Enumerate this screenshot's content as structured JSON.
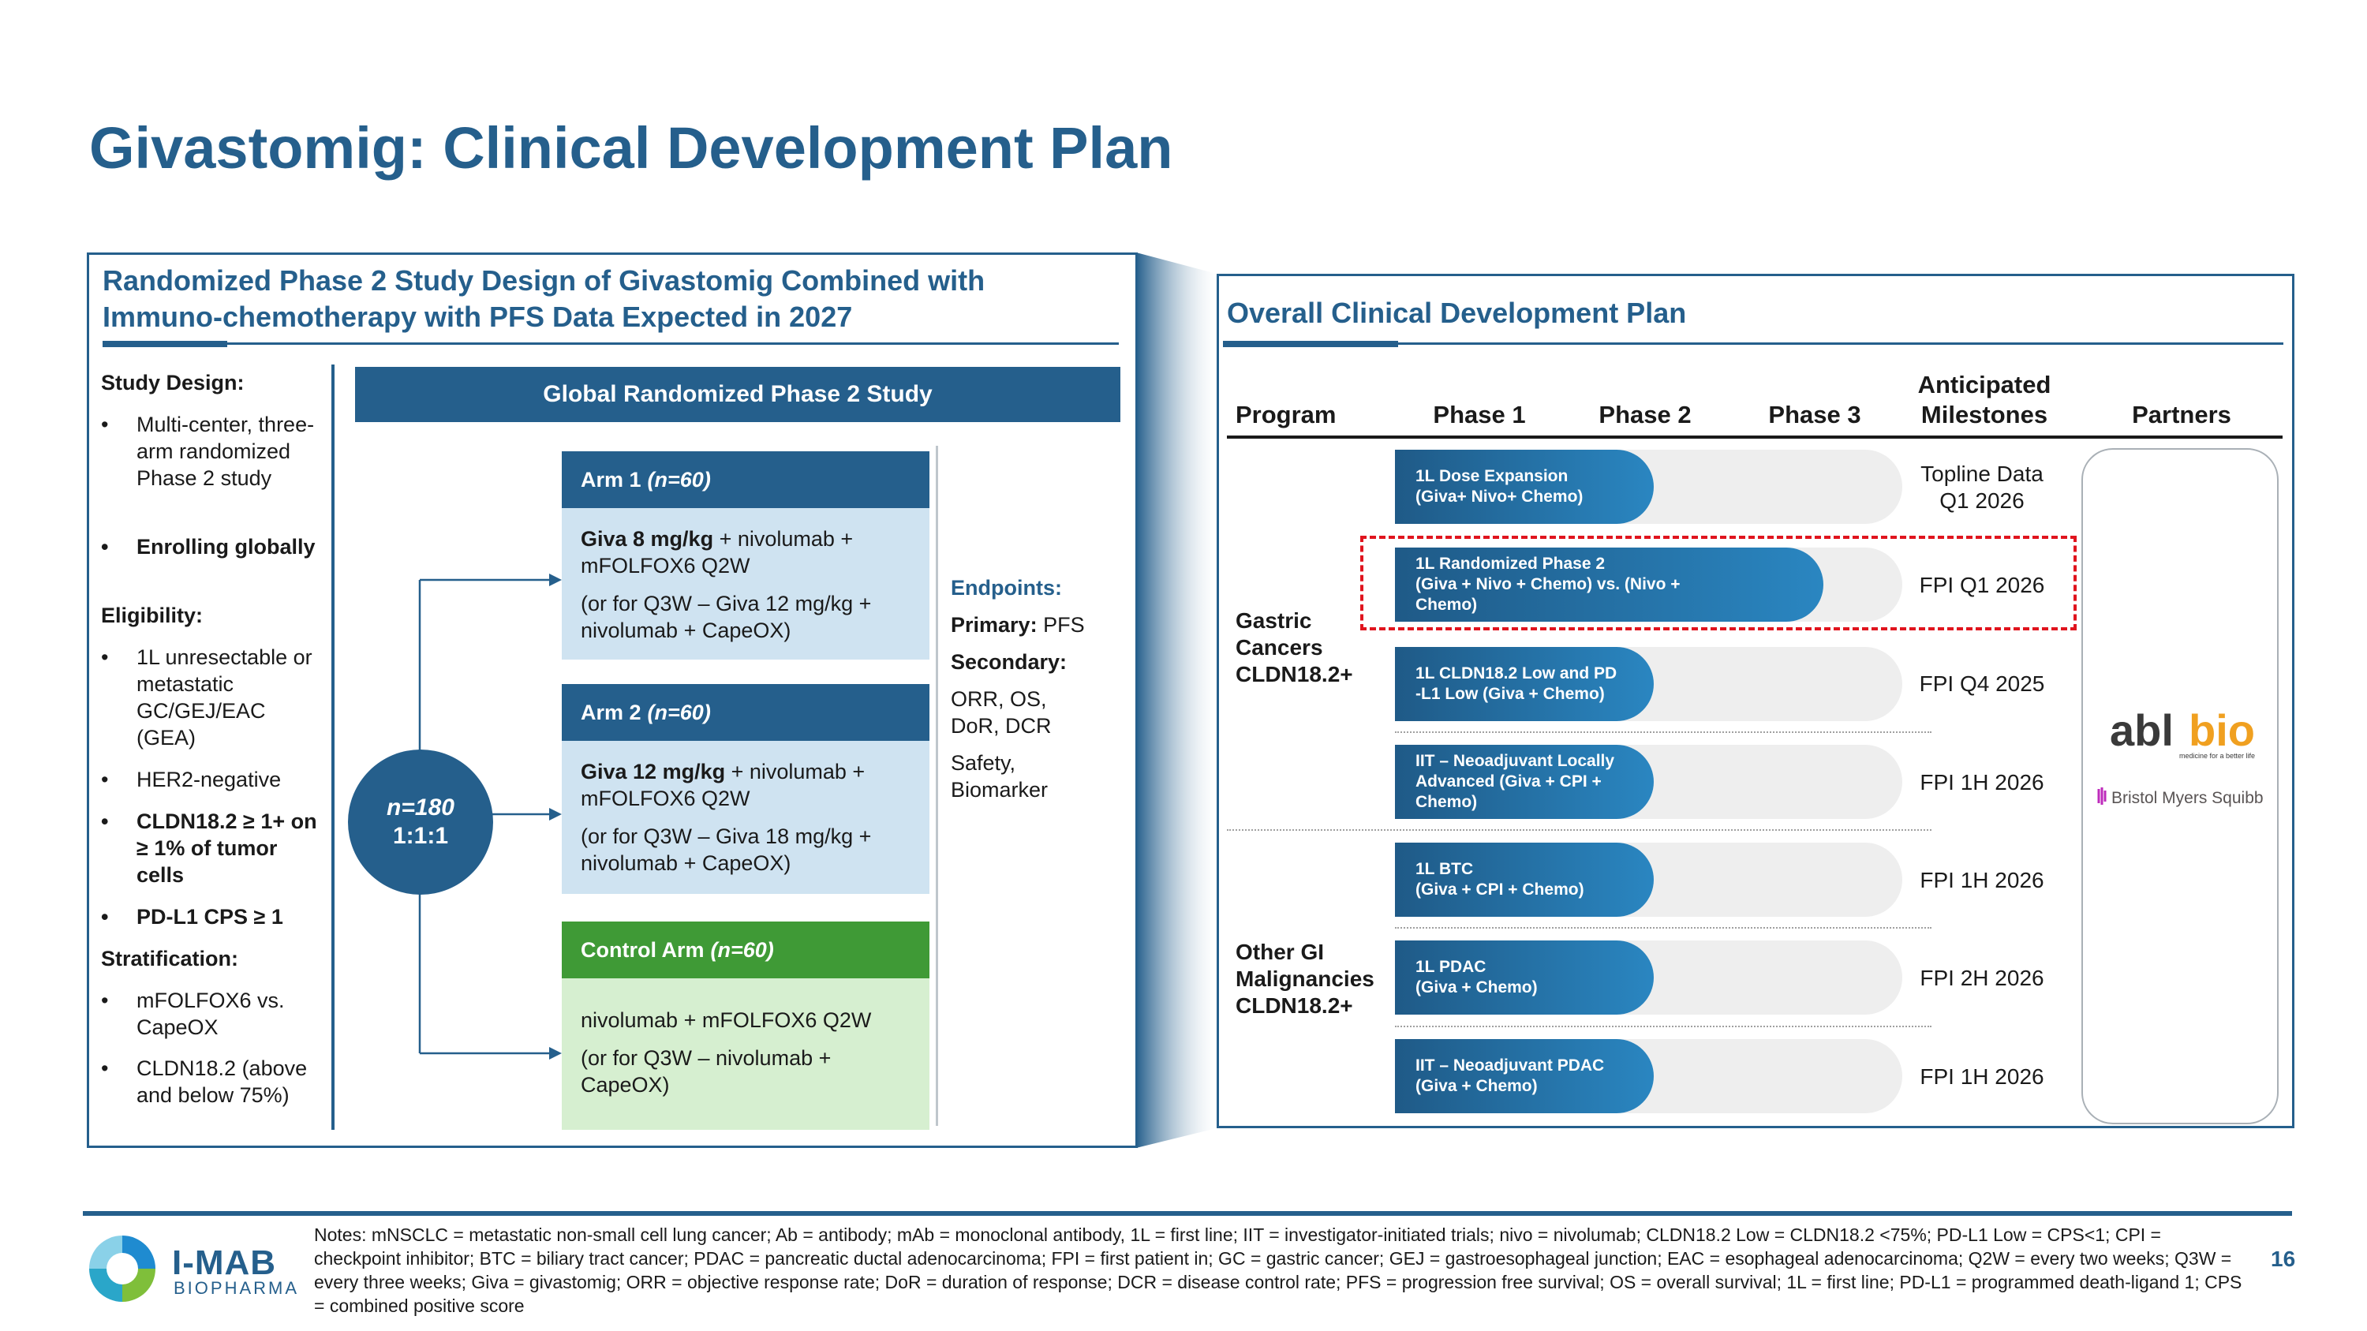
{
  "title": "Givastomig: Clinical Development Plan",
  "left_panel": {
    "heading_line1": "Randomized Phase 2 Study Design of Givastomig Combined with",
    "heading_line2": "Immuno-chemotherapy with PFS Data Expected in 2027",
    "study_design": {
      "heading": "Study Design:",
      "bullet1": "Multi-center, three-arm randomized Phase 2 study",
      "bullet2": "Enrolling globally"
    },
    "eligibility": {
      "heading": "Eligibility:",
      "bullet1": "1L unresectable or metastatic GC/GEJ/EAC (GEA)",
      "bullet2": "HER2-negative",
      "bullet3": "CLDN18.2 ≥ 1+ on ≥ 1% of tumor cells",
      "bullet4": "PD-L1 CPS ≥ 1"
    },
    "stratification": {
      "heading": "Stratification:",
      "bullet1": "mFOLFOX6 vs. CapeOX",
      "bullet2": "CLDN18.2 (above and below 75%)"
    },
    "banner": "Global Randomized Phase 2 Study",
    "circle_n": "n=180",
    "circle_ratio": "1:1:1",
    "arm1": {
      "label": "Arm 1",
      "n": "(n=60)",
      "dose_bold": "Giva 8 mg/kg",
      "dose_rest": " + nivolumab + mFOLFOX6 Q2W",
      "alt": "(or for Q3W – Giva 12 mg/kg + nivolumab + CapeOX)"
    },
    "arm2": {
      "label": "Arm 2",
      "n": "(n=60)",
      "dose_bold": "Giva 12 mg/kg",
      "dose_rest": " + nivolumab + mFOLFOX6 Q2W",
      "alt": "(or for Q3W – Giva 18 mg/kg + nivolumab + CapeOX)"
    },
    "control": {
      "label": "Control Arm",
      "n": "(n=60)",
      "regimen": "nivolumab + mFOLFOX6 Q2W",
      "alt": "(or for Q3W – nivolumab + CapeOX)"
    },
    "endpoints": {
      "heading": "Endpoints:",
      "primary_label": "Primary:",
      "primary_value": " PFS",
      "secondary_label": "Secondary:",
      "secondary_value": "ORR, OS, DoR, DCR",
      "other": "Safety, Biomarker"
    }
  },
  "right_panel": {
    "heading": "Overall Clinical Development Plan",
    "columns": {
      "program": "Program",
      "phase1": "Phase 1",
      "phase2": "Phase 2",
      "phase3": "Phase 3",
      "milestones_line1": "Anticipated",
      "milestones_line2": "Milestones",
      "partners": "Partners"
    },
    "groups": [
      {
        "name_line1": "Gastric",
        "name_line2": "Cancers",
        "name_line3": "CLDN18.2+"
      },
      {
        "name_line1": "Other GI",
        "name_line2": "Malignancies",
        "name_line3": "CLDN18.2+"
      }
    ],
    "rows": [
      {
        "line1": "1L Dose Expansion",
        "line2": "(Giva+ Nivo+ Chemo)",
        "line3": "",
        "milestone_line1": "Topline Data",
        "milestone_line2": "Q1 2026",
        "phase_progress": 1.0
      },
      {
        "line1": "1L Randomized Phase 2",
        "line2": "(Giva + Nivo + Chemo) vs. (Nivo +",
        "line3": "Chemo)",
        "milestone_line1": "FPI Q1 2026",
        "milestone_line2": "",
        "phase_progress": 2.0
      },
      {
        "line1": "1L CLDN18.2 Low and PD",
        "line2": "-L1 Low (Giva + Chemo)",
        "line3": "",
        "milestone_line1": "FPI Q4 2025",
        "milestone_line2": "",
        "phase_progress": 1.0
      },
      {
        "line1": "IIT – Neoadjuvant Locally",
        "line2": "Advanced (Giva + CPI +",
        "line3": "Chemo)",
        "milestone_line1": "FPI 1H 2026",
        "milestone_line2": "",
        "phase_progress": 1.0
      },
      {
        "line1": "1L BTC",
        "line2": "(Giva + CPI + Chemo)",
        "line3": "",
        "milestone_line1": "FPI 1H 2026",
        "milestone_line2": "",
        "phase_progress": 1.0
      },
      {
        "line1": "1L PDAC",
        "line2": "(Giva + Chemo)",
        "line3": "",
        "milestone_line1": "FPI 2H 2026",
        "milestone_line2": "",
        "phase_progress": 1.0
      },
      {
        "line1": "IIT – Neoadjuvant PDAC",
        "line2": "(Giva + Chemo)",
        "line3": "",
        "milestone_line1": "FPI 1H 2026",
        "milestone_line2": "",
        "phase_progress": 1.0
      }
    ],
    "partners": {
      "ablbio_main_a": "abl",
      "ablbio_main_b": "bio",
      "ablbio_tagline": "medicine for a better life",
      "bms": "Bristol Myers Squibb"
    }
  },
  "footer": {
    "notes": "Notes: mNSCLC = metastatic non-small cell lung cancer; Ab = antibody; mAb = monoclonal antibody, 1L = first line; IIT = investigator-initiated trials; nivo = nivolumab; CLDN18.2 Low = CLDN18.2 <75%; PD-L1 Low = CPS<1; CPI = checkpoint inhibitor; BTC = biliary tract cancer; PDAC = pancreatic ductal adenocarcinoma; FPI = first patient in; GC = gastric cancer; GEJ = gastroesophageal junction; EAC = esophageal adenocarcinoma; Q2W = every two weeks; Q3W = every three weeks; Giva = givastomig; ORR = objective response rate; DoR = duration of response; DCR = disease control rate; PFS = progression free survival; OS = overall survival; 1L = first line; PD-L1 = programmed death-ligand 1; CPS = combined positive score",
    "page_number": "16",
    "company_name": "I-MAB",
    "company_sub": "BIOPHARMA"
  },
  "colors": {
    "brand_blue": "#255f8c",
    "arm_light_blue": "#cfe3f1",
    "control_green": "#3f9a36",
    "control_light_green": "#d6efd0",
    "highlight_red": "#e0141e"
  }
}
